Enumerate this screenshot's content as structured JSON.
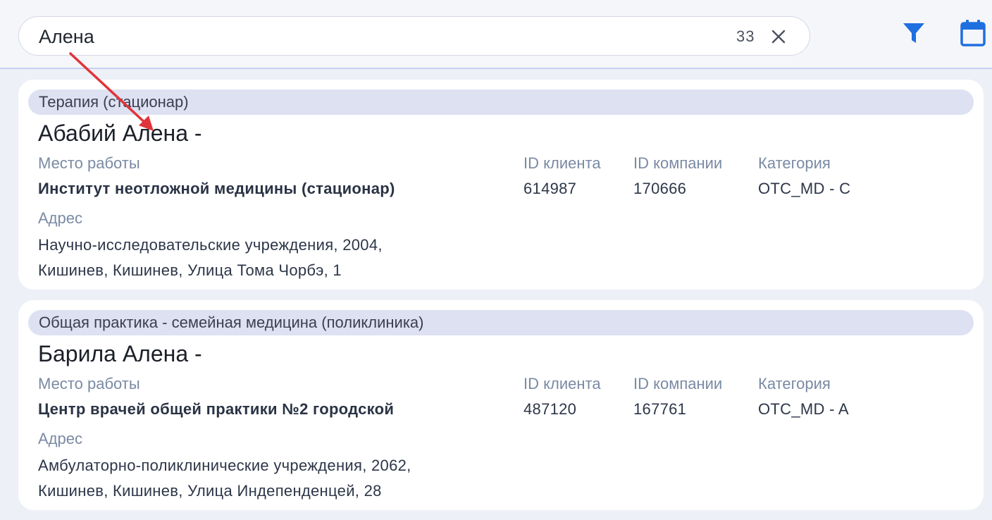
{
  "search": {
    "value": "Алена",
    "count": "33"
  },
  "colors": {
    "accent": "#1f6fe0",
    "specialty_bg": "#dde1f1",
    "annotation_arrow": "#e0343a"
  },
  "icons": [
    "close-icon",
    "filter-icon",
    "calendar-icon"
  ],
  "results": [
    {
      "specialty": "Терапия (стационар)",
      "name": "Абабий Алена -",
      "workplace_label": "Место работы",
      "workplace": "Институт неотложной медицины (стационар)",
      "client_id_label": "ID клиента",
      "client_id": "614987",
      "company_id_label": "ID компании",
      "company_id": "170666",
      "category_label": "Категория",
      "category": "OTC_MD - C",
      "address_label": "Адрес",
      "address_line1": "Научно-исследовательские учреждения, 2004,",
      "address_line2": "Кишинев, Кишинев, Улица Тома Чорбэ, 1"
    },
    {
      "specialty": "Общая практика - семейная медицина (поликлиника)",
      "name": "Барила Алена -",
      "workplace_label": "Место работы",
      "workplace": "Центр врачей общей практики №2 городской",
      "client_id_label": "ID клиента",
      "client_id": "487120",
      "company_id_label": "ID компании",
      "company_id": "167761",
      "category_label": "Категория",
      "category": "OTC_MD - A",
      "address_label": "Адрес",
      "address_line1": "Амбулаторно-поликлинические учреждения, 2062,",
      "address_line2": "Кишинев, Кишинев, Улица Индепенденцей, 28"
    }
  ]
}
